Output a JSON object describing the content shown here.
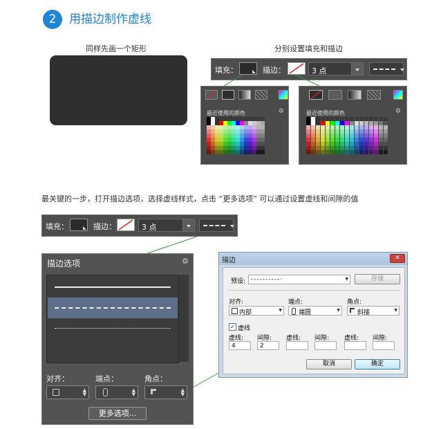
{
  "heading": {
    "step_number": "2",
    "title": "用描边制作虚线"
  },
  "captions": {
    "rect": "同样先画一个矩形",
    "fill_stroke": "分别设置填充和描边",
    "key_step": "最关键的一步，打开描边选项，选择虚线样式，点击 “更多选项” 可以通过设置虚线和间隙的值"
  },
  "toolbar": {
    "fill_label": "填充：",
    "stroke_label": "描边：",
    "stroke_width": "3 点"
  },
  "swatch_panel": {
    "recent_label": "最近使用的颜色"
  },
  "stroke_panel": {
    "title": "描边选项",
    "align_label": "对齐：",
    "caps_label": "端点：",
    "corners_label": "角点：",
    "more_button": "更多选项..."
  },
  "dialog": {
    "title": "描边",
    "close": "✕",
    "preset_label": "预设:",
    "preset_value": "----------·",
    "save_button": "存储",
    "align_label": "对齐:",
    "align_value": "内部",
    "caps_label": "端点:",
    "caps_value": "端圆",
    "corners_label": "角点:",
    "corners_value": "斜接",
    "dashed_label": "虚线",
    "dash1_label": "虚线:",
    "gap1_label": "间隙:",
    "dash2_label": "虚线:",
    "gap2_label": "间隙:",
    "dash3_label": "虚线:",
    "gap3_label": "间隙:",
    "dash1_value": "4",
    "gap1_value": "2",
    "cancel_button": "取消",
    "ok_button": "确定"
  },
  "colors": {
    "accent": "#1f84d4",
    "connector": "#3a9a3a"
  }
}
